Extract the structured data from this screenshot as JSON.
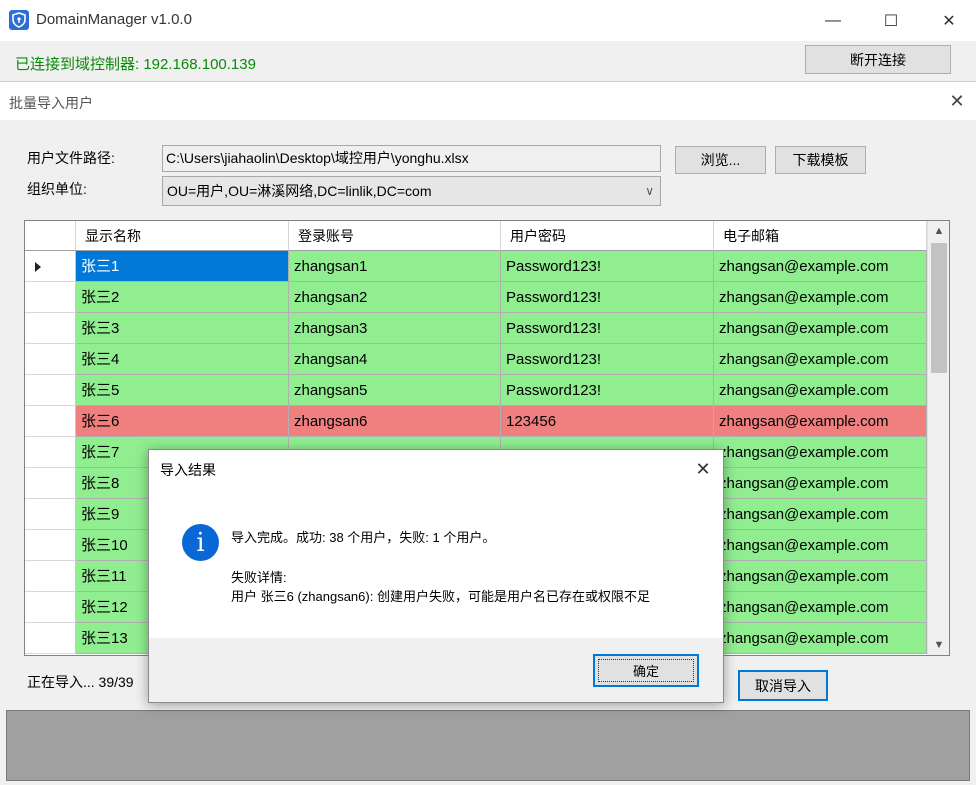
{
  "app": {
    "title": "DomainManager v1.0.0",
    "window_controls": {
      "minimize": "—",
      "maximize": "☐",
      "close": "✕"
    },
    "connection_status": "已连接到域控制器: 192.168.100.139",
    "disconnect_label": "断开连接"
  },
  "import_dialog": {
    "title": "批量导入用户",
    "close_glyph": "✕",
    "file_path_label": "用户文件路径:",
    "file_path_value": "C:\\Users\\jiahaolin\\Desktop\\域控用户\\yonghu.xlsx",
    "browse_label": "浏览...",
    "download_template_label": "下载模板",
    "ou_label": "组织单位:",
    "ou_selected": "OU=用户,OU=淋溪网络,DC=linlik,DC=com",
    "progress_text": "正在导入... 39/39",
    "cancel_label": "取消导入"
  },
  "grid": {
    "columns": [
      "显示名称",
      "登录账号",
      "用户密码",
      "电子邮箱"
    ],
    "rows": [
      {
        "name": "张三1",
        "account": "zhangsan1",
        "password": "Password123!",
        "email": "zhangsan@example.com",
        "status": "ok",
        "selected": true
      },
      {
        "name": "张三2",
        "account": "zhangsan2",
        "password": "Password123!",
        "email": "zhangsan@example.com",
        "status": "ok"
      },
      {
        "name": "张三3",
        "account": "zhangsan3",
        "password": "Password123!",
        "email": "zhangsan@example.com",
        "status": "ok"
      },
      {
        "name": "张三4",
        "account": "zhangsan4",
        "password": "Password123!",
        "email": "zhangsan@example.com",
        "status": "ok"
      },
      {
        "name": "张三5",
        "account": "zhangsan5",
        "password": "Password123!",
        "email": "zhangsan@example.com",
        "status": "ok"
      },
      {
        "name": "张三6",
        "account": "zhangsan6",
        "password": "123456",
        "email": "zhangsan@example.com",
        "status": "fail"
      },
      {
        "name": "张三7",
        "account": "",
        "password": "",
        "email": "zhangsan@example.com",
        "status": "ok"
      },
      {
        "name": "张三8",
        "account": "",
        "password": "",
        "email": "zhangsan@example.com",
        "status": "ok"
      },
      {
        "name": "张三9",
        "account": "",
        "password": "",
        "email": "zhangsan@example.com",
        "status": "ok"
      },
      {
        "name": "张三10",
        "account": "",
        "password": "",
        "email": "zhangsan@example.com",
        "status": "ok"
      },
      {
        "name": "张三11",
        "account": "",
        "password": "",
        "email": "zhangsan@example.com",
        "status": "ok"
      },
      {
        "name": "张三12",
        "account": "",
        "password": "",
        "email": "zhangsan@example.com",
        "status": "ok"
      },
      {
        "name": "张三13",
        "account": "",
        "password": "",
        "email": "zhangsan@example.com",
        "status": "ok"
      }
    ]
  },
  "message_box": {
    "title": "导入结果",
    "close_glyph": "✕",
    "icon": "info-icon",
    "icon_glyph": "i",
    "summary": "导入完成。成功: 38 个用户，失败: 1 个用户。",
    "detail_heading": "失败详情:",
    "detail_line": "用户 张三6 (zhangsan6): 创建用户失败，可能是用户名已存在或权限不足",
    "ok_label": "确定"
  },
  "colors": {
    "row_ok": "#90ee90",
    "row_fail": "#f08080",
    "selection": "#0078d7",
    "status_green": "#0a8a0a",
    "info_blue": "#0a67d6"
  }
}
